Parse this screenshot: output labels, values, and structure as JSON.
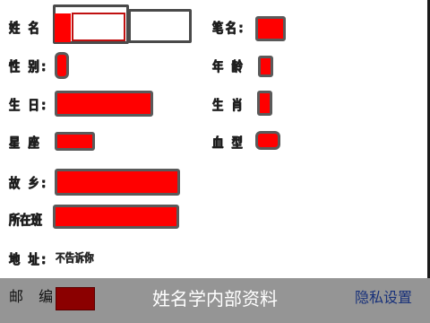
{
  "form": {
    "name_label": "姓 名",
    "pen_name_label": "笔名:",
    "gender_label": "性 别:",
    "age_label": "年 龄",
    "birthday_label": "生 日:",
    "zodiac_label": "生 肖",
    "constellation_label": "星 座",
    "blood_type_label": "血 型",
    "hometown_label": "故 乡:",
    "school_label": "所在班",
    "address_label": "地 址:",
    "address_value": "不告诉你",
    "postal_label": "邮 编:"
  },
  "footer": {
    "title": "姓名学内部资料",
    "privacy_link": "隐私设置"
  },
  "colors": {
    "field_fill": "#ff0000",
    "postal_fill": "#8b0000",
    "bottom_bar": "#959595",
    "link": "#17307a"
  }
}
